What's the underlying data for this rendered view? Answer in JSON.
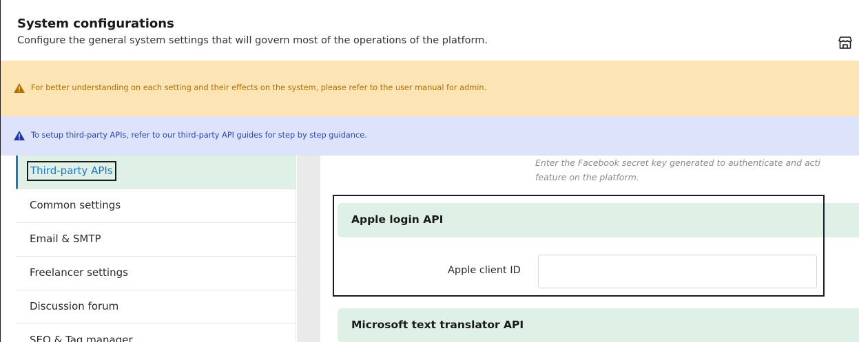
{
  "header": {
    "title": "System configurations",
    "subtitle": "Configure the general system settings that will govern most of the operations of the platform.",
    "icon": "store-icon"
  },
  "banners": {
    "warning": {
      "text": "For better understanding on each setting and their effects on the system, please refer to the user manual for admin.",
      "icon": "warning-icon",
      "background": "#fde4b5",
      "color": "#b46d00"
    },
    "info": {
      "text": "To setup third-party APIs, refer to our third-party API guides for step by step guidance.",
      "icon": "info-triangle-icon",
      "background": "#dde3fb",
      "color": "#2d45b8"
    }
  },
  "sidebar": {
    "items": [
      {
        "label": "Third-party APIs",
        "active": true
      },
      {
        "label": "Common settings"
      },
      {
        "label": "Email & SMTP"
      },
      {
        "label": "Freelancer settings"
      },
      {
        "label": "Discussion forum"
      },
      {
        "label": "SEO & Tag manager"
      }
    ]
  },
  "main": {
    "facebook_helper": {
      "line1": "Enter the Facebook secret key generated to authenticate and acti",
      "line2": "feature on the platform."
    },
    "apple_section": {
      "title": "Apple login API",
      "client_id_label": "Apple client ID",
      "client_id_value": "",
      "client_id_placeholder": ""
    },
    "microsoft_section": {
      "title": "Microsoft text translator API"
    }
  },
  "colors": {
    "accent_green": "#dff1e6",
    "active_link": "#2074c2"
  }
}
